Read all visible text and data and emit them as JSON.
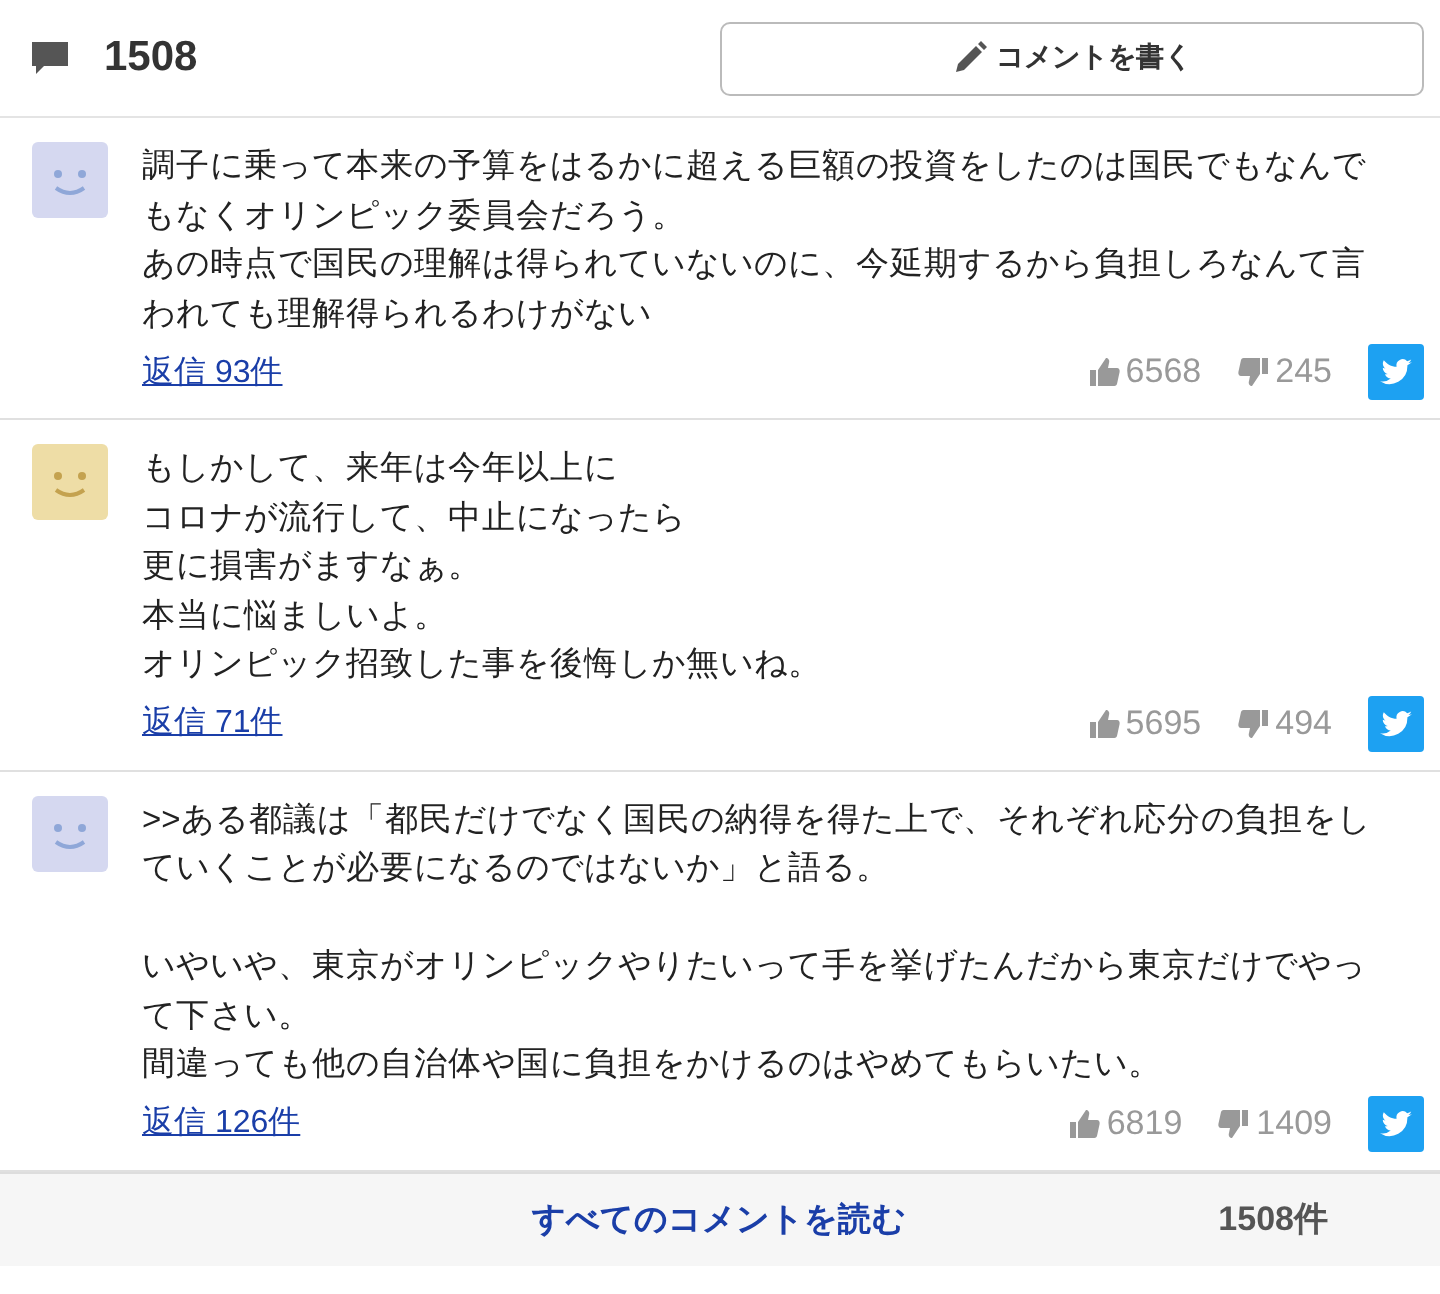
{
  "header": {
    "count": "1508",
    "write_button": "コメントを書く"
  },
  "comments": [
    {
      "color": "#d5d8f0",
      "paragraphs": [
        [
          "調子に乗って本来の予算をはるかに超える巨額の投資をしたのは国民でもなんで",
          "もなくオリンピック委員会だろう。",
          "あの時点で国民の理解は得られていないのに、今延期するから負担しろなんて言",
          "われても理解得られるわけがない"
        ]
      ],
      "replies": "返信 93件",
      "likes": "6568",
      "dislikes": "245"
    },
    {
      "color": "#eedda6",
      "paragraphs": [
        [
          "もしかして、来年は今年以上に",
          "コロナが流行して、中止になったら",
          "更に損害がますなぁ。",
          "本当に悩ましいよ。",
          "オリンピック招致した事を後悔しか無いね。"
        ]
      ],
      "replies": "返信 71件",
      "likes": "5695",
      "dislikes": "494"
    },
    {
      "color": "#d5d8f0",
      "paragraphs": [
        [
          ">>ある都議は「都民だけでなく国民の納得を得た上で、それぞれ応分の負担をし",
          "ていくことが必要になるのではないか」と語る。"
        ],
        [
          "いやいや、東京がオリンピックやりたいって手を挙げたんだから東京だけでやっ",
          "て下さい。",
          "間違っても他の自治体や国に負担をかけるのはやめてもらいたい。"
        ]
      ],
      "replies": "返信 126件",
      "likes": "6819",
      "dislikes": "1409"
    }
  ],
  "footer": {
    "read_all": "すべてのコメントを読む",
    "total": "1508件"
  }
}
